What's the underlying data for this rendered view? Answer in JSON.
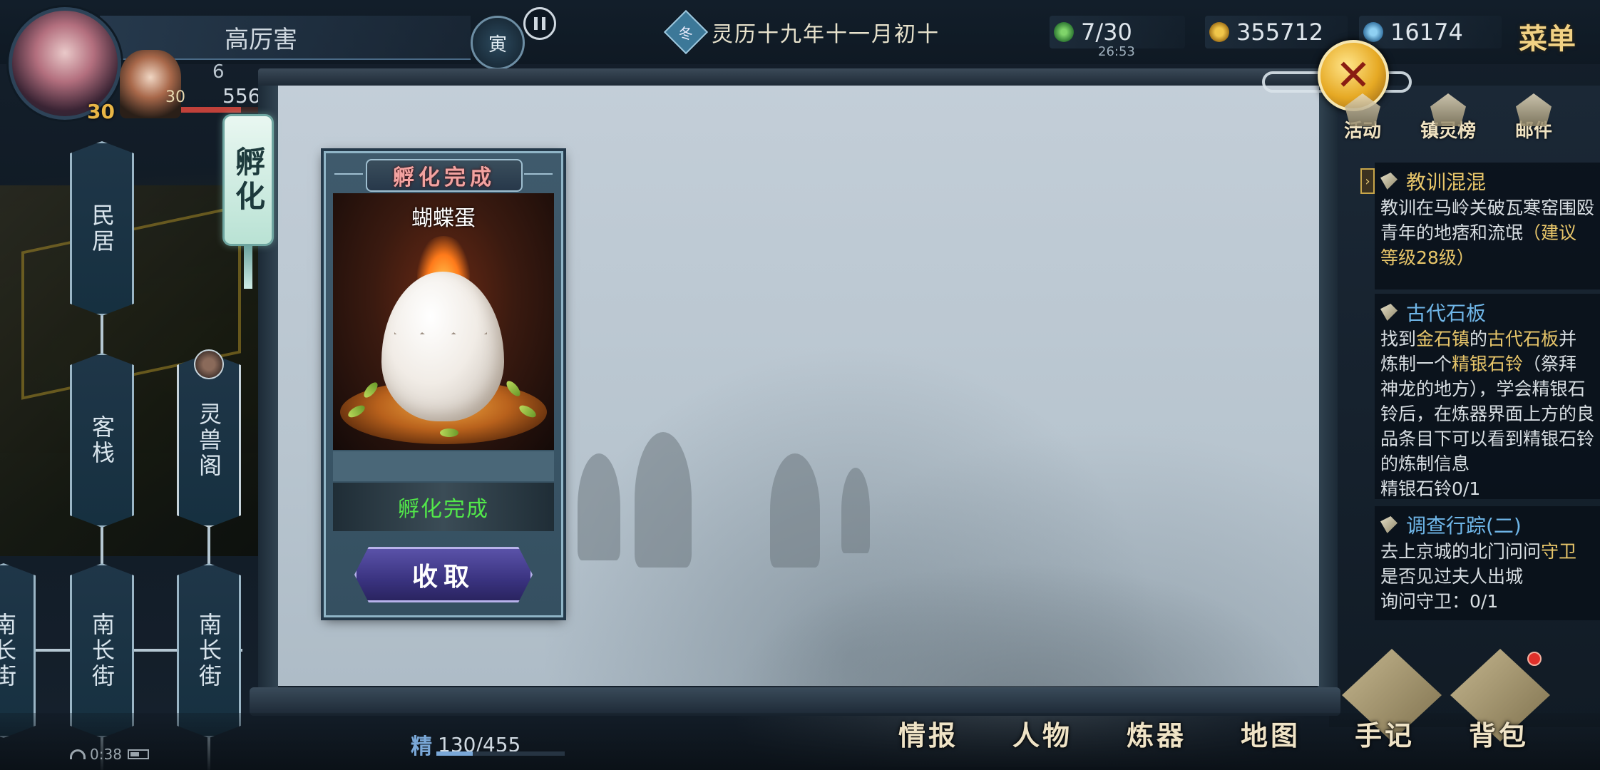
{
  "header": {
    "player_name": "高厉害",
    "main_level": "30",
    "companion_level": "30",
    "hp_value": "556",
    "top_partial_value": "6",
    "time_badge": "寅",
    "calendar_icon": "冬",
    "date": "灵历十九年十一月初十",
    "stamina": "7/30",
    "stamina_timer": "26:53",
    "coins": "355712",
    "spirit_stones": "16174",
    "menu_label": "菜单"
  },
  "locations": {
    "minju": "民居",
    "kezhan": "客栈",
    "lingshouge": "灵兽阁",
    "nanchangjie_left": "南长街",
    "nanchangjie_mid": "南长街",
    "nanchangjie_right": "南长街"
  },
  "side_tab": {
    "label": "孵化"
  },
  "hatch_card": {
    "title": "孵化完成",
    "pet_name": "蝴蝶蛋",
    "status": "孵化完成",
    "collect_label": "收取"
  },
  "top_right_icons": {
    "activity": "活动",
    "ranking": "镇灵榜",
    "mail": "邮件"
  },
  "quests": [
    {
      "title": "教训混混",
      "body_a": "教训在马岭关破瓦寒窑围殴青年的地痞和流氓",
      "body_hl": "（建议等级28级）"
    },
    {
      "title": "古代石板",
      "p1": "找到",
      "p2": "金石镇",
      "p3": "的",
      "p4": "古代石板",
      "p5": "并炼制一个",
      "p6": "精银石铃",
      "p7": "（祭拜神龙的地方），学会精银石铃后，在炼器界面上方的良品条目下可以看到精银石铃的炼制信息",
      "progress": "精银石铃0/1"
    },
    {
      "title": "调查行踪(二)",
      "p1": "去上京城的北门问问",
      "p2": "守卫",
      "p3": "是否见过夫人出城",
      "progress": "询问守卫：0/1"
    }
  ],
  "bottom": {
    "status_time": "0:38",
    "essence_label": "精",
    "essence_value": "130/455",
    "nav": [
      "情报",
      "人物",
      "炼器",
      "地图",
      "手记",
      "背包"
    ]
  },
  "colors": {
    "status_green": "#52e84a",
    "quest_gold": "#e8c66a",
    "quest_blue": "#6fb6e8",
    "title_pink": "#f2a2a0"
  }
}
